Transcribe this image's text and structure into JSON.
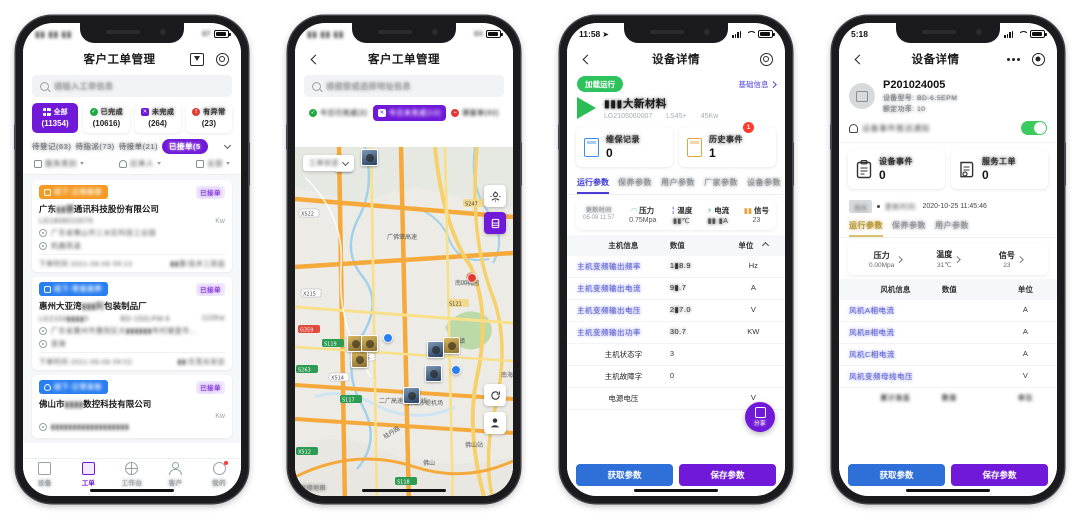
{
  "phone1": {
    "status": {
      "time_blurred": "▮▮ ▮▮ ▮▮",
      "battery": "87"
    },
    "nav": {
      "title": "客户工单管理",
      "upload_icon": "upload-icon",
      "gear_icon": "gear-icon"
    },
    "search": {
      "placeholder": "请输入工单信息"
    },
    "stats": [
      {
        "label": "全部",
        "count": "(11354)",
        "icon": "grid-icon",
        "color": "#7019d8",
        "active": true
      },
      {
        "label": "已完成",
        "count": "(10616)",
        "icon": "check-circle-icon",
        "color": "#22a745",
        "active": false
      },
      {
        "label": "未完成",
        "count": "(264)",
        "icon": "cross-square-icon",
        "color": "#7019d8",
        "active": false
      },
      {
        "label": "有异常",
        "count": "(23)",
        "icon": "alert-icon",
        "color": "#e03b36",
        "active": false
      }
    ],
    "chips": [
      {
        "label": "待登记(63)",
        "active": false
      },
      {
        "label": "待指派(73)",
        "active": false
      },
      {
        "label": "待接单(21)",
        "active": false
      },
      {
        "label": "已接单(5",
        "active": true
      }
    ],
    "filters": [
      {
        "label": "服务类别",
        "icon": "calendar-icon"
      },
      {
        "label": "应单人",
        "icon": "person-icon"
      },
      {
        "label": "全部",
        "icon": "list-icon"
      }
    ],
    "orders": [
      {
        "tag": "线下-过保维修",
        "tag_color": "#f59a23",
        "tag_icon": "wrench-icon",
        "badge": "已接单",
        "company": "广东▮▮德通讯科技股份有限公司",
        "code": "LG1808010075",
        "model": "",
        "power": "Kw",
        "address": "广东省佛山市三水区科技工业园",
        "issue": "机器高温",
        "time_label": "下单时间 2021-06-08 09:13",
        "assignee": "▮▮康/技术三高组"
      },
      {
        "tag": "线下-常规保养",
        "tag_color": "#2a7ff0",
        "tag_icon": "search-wrench-icon",
        "badge": "已接单",
        "company": "惠州大亚湾▮▮▮利包装制品厂",
        "code": "LG2104▮▮▮▮5",
        "model": "BD-150LPM-Ⅱ",
        "power": "110Kw",
        "address": "广东省惠州市惠阳区大▮▮▮▮▮▮布村塘壹市…",
        "issue": "首保",
        "time_label": "下单时间 2021-06-08 09:02",
        "assignee": "▮▮/东莞长安店"
      },
      {
        "tag": "线下-日常巡检",
        "tag_color": "#2a7ff0",
        "tag_icon": "eye-icon",
        "badge": "已接单",
        "company": "佛山市▮▮▮▮数控科技有限公司",
        "code": "",
        "model": "",
        "power": "Kw",
        "address": "",
        "issue": "",
        "time_label": "",
        "assignee": ""
      }
    ],
    "tabbar": [
      {
        "label": "设备",
        "icon": "device-icon",
        "active": false,
        "dot": false
      },
      {
        "label": "工单",
        "icon": "order-icon",
        "active": true,
        "dot": false
      },
      {
        "label": "工作台",
        "icon": "workbench-icon",
        "active": false,
        "dot": false
      },
      {
        "label": "客户",
        "icon": "customer-icon",
        "active": false,
        "dot": false
      },
      {
        "label": "我的",
        "icon": "profile-icon",
        "active": false,
        "dot": true
      }
    ]
  },
  "phone2": {
    "status": {
      "time_blurred": "▮▮ ▮▮ ▮▮",
      "battery": "84"
    },
    "nav": {
      "title": "客户工单管理",
      "back_icon": "chevron-left-icon"
    },
    "search": {
      "placeholder": "请搜索或选择地址信息"
    },
    "chips": [
      {
        "label": "今日已完成(2)",
        "active": false,
        "color": "#22a745",
        "icon": "check-circle-icon"
      },
      {
        "label": "今日未完成(13)",
        "active": true,
        "color": "#7019d8",
        "icon": "cross-square-icon"
      },
      {
        "label": "滞留单(92)",
        "active": false,
        "color": "#e03b36",
        "icon": "minus-circle-icon"
      }
    ],
    "map": {
      "status_selector": "工单状态",
      "fab_locate": "locate-icon",
      "fab_layers": "layers-icon",
      "fab_refresh": "refresh-icon",
      "fab_person": "person-marker-icon",
      "attribution": "高德地图",
      "labels": [
        "X522",
        "X215",
        "X514",
        "S263",
        "X512",
        "S247",
        "S121",
        "G359",
        "X515",
        "广佛肇高速",
        "二广高速广州支线",
        "南国桃园",
        "大沥镇",
        "佛山",
        "佛山站",
        "佛山沙堤机场",
        "佛山",
        "桂丹路",
        "南海"
      ]
    }
  },
  "phone3": {
    "status": {
      "time": "11:58",
      "battery": "100"
    },
    "nav": {
      "title": "设备详情",
      "back_icon": "chevron-left-icon",
      "gear_icon": "gear-icon"
    },
    "run_state": "加载运行",
    "basic_info_link": "基础信息",
    "device": {
      "name": "▮▮▮大新材料",
      "code": "LG2105060007",
      "model": "LS45+",
      "power": "45Kw"
    },
    "cards": [
      {
        "label": "维保记录",
        "value": "0",
        "icon": "maintenance-icon",
        "badge": ""
      },
      {
        "label": "历史事件",
        "value": "1",
        "icon": "history-icon",
        "badge": "1"
      }
    ],
    "tabs": [
      {
        "label": "运行参数",
        "active": true
      },
      {
        "label": "保养参数",
        "active": false
      },
      {
        "label": "用户参数",
        "active": false
      },
      {
        "label": "厂家参数",
        "active": false
      },
      {
        "label": "设备参数",
        "active": false
      }
    ],
    "strip": [
      {
        "key": "更新时间",
        "value": "06-08 11:57",
        "icon": ""
      },
      {
        "key": "压力",
        "value": "0.75Mpa",
        "icon": "gauge-icon"
      },
      {
        "key": "温度",
        "value": "▮▮℃",
        "icon": "thermometer-icon"
      },
      {
        "key": "电流",
        "value": "▮▮ ▮A",
        "icon": "current-icon"
      },
      {
        "key": "信号",
        "value": "23",
        "icon": "signal-icon"
      }
    ],
    "table": {
      "headers": [
        "主机信息",
        "数值",
        "单位"
      ],
      "rows": [
        {
          "name": "主机变频输出频率",
          "value": "1▮8.9",
          "unit": "Hz",
          "highlight": true
        },
        {
          "name": "主机变频输出电流",
          "value": "9▮.7",
          "unit": "A",
          "highlight": true
        },
        {
          "name": "主机变频输出电压",
          "value": "2▮7.0",
          "unit": "V",
          "highlight": true
        },
        {
          "name": "主机变频输出功率",
          "value": "30.7",
          "unit": "KW",
          "highlight": true
        },
        {
          "name": "主机状态字",
          "value": "3",
          "unit": "",
          "highlight": false
        },
        {
          "name": "主机故障字",
          "value": "0",
          "unit": "",
          "highlight": false
        },
        {
          "name": "电源电压",
          "value": "",
          "unit": "V",
          "highlight": false
        }
      ]
    },
    "share_fab": "分享",
    "buttons": [
      {
        "label": "获取参数",
        "style": "blue"
      },
      {
        "label": "保存参数",
        "style": "purple"
      }
    ]
  },
  "phone4": {
    "status": {
      "time": "5:18",
      "battery": "100"
    },
    "nav": {
      "title": "设备详情",
      "back_icon": "chevron-left-icon",
      "more_icon": "more-icon",
      "target_icon": "target-icon"
    },
    "device": {
      "name": "P201024005",
      "model_label": "设备型号:",
      "model": "BD-6.5EPM",
      "power_label": "额定功率:",
      "power": "10"
    },
    "toggle": {
      "label": "设备事件推送通知",
      "on": true,
      "icon": "bell-icon"
    },
    "cards": [
      {
        "label": "设备事件",
        "value": "0",
        "icon": "event-icon"
      },
      {
        "label": "服务工单",
        "value": "0",
        "icon": "service-order-icon"
      }
    ],
    "update": {
      "badge": "离线",
      "label": "更新时间:",
      "time": "2020-10-25 11:45:46"
    },
    "tabs": [
      {
        "label": "运行参数",
        "active": true
      },
      {
        "label": "保养参数",
        "active": false
      },
      {
        "label": "用户参数",
        "active": false
      }
    ],
    "strip": [
      {
        "key": "压力",
        "value": "0.00Mpa"
      },
      {
        "key": "温度",
        "value": "31℃"
      },
      {
        "key": "信号",
        "value": "23"
      }
    ],
    "table": {
      "headers": [
        "风机信息",
        "数值",
        "单位"
      ],
      "rows": [
        {
          "name": "风机A相电流",
          "value": "",
          "unit": "A"
        },
        {
          "name": "风机B相电流",
          "value": "",
          "unit": "A"
        },
        {
          "name": "风机C相电流",
          "value": "",
          "unit": "A"
        },
        {
          "name": "风机变频母线电压",
          "value": "",
          "unit": "V"
        }
      ],
      "headers2": [
        "累计信息",
        "数值",
        "单位"
      ]
    },
    "buttons": [
      {
        "label": "获取参数",
        "style": "blue"
      },
      {
        "label": "保存参数",
        "style": "purple"
      }
    ]
  }
}
